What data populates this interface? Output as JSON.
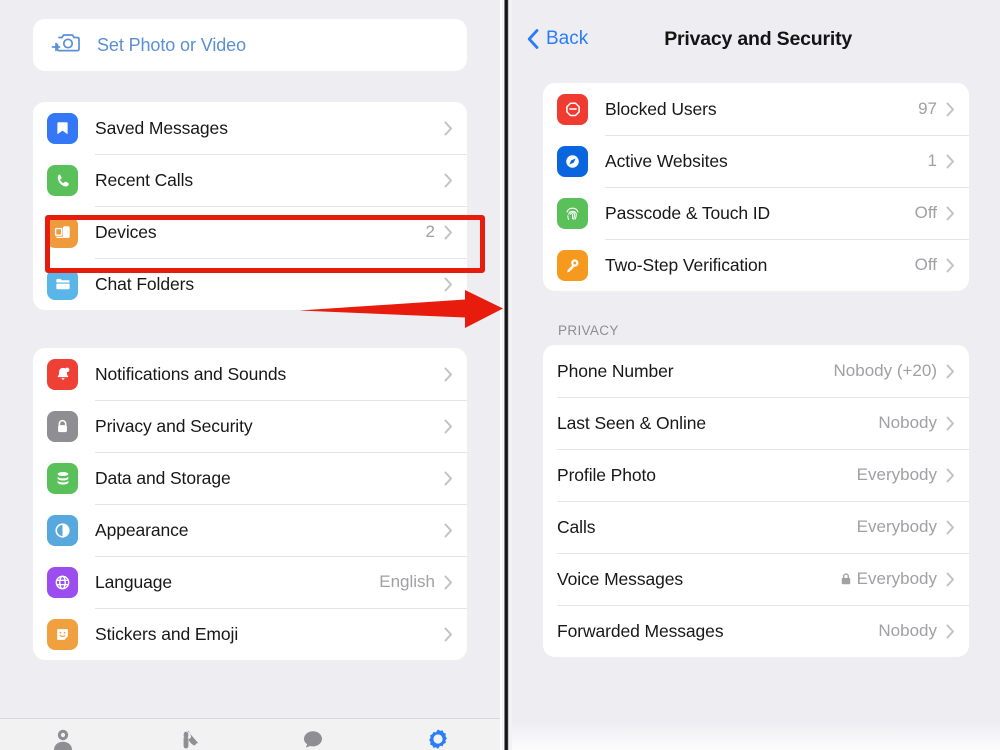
{
  "left_panel": {
    "set_photo": {
      "label": "Set Photo or Video",
      "icon": "camera-plus-icon",
      "color": "#5b8fd6"
    },
    "group_one": [
      {
        "label": "Saved Messages",
        "value": "",
        "icon": "bookmark-icon",
        "color": "#3478f6"
      },
      {
        "label": "Recent Calls",
        "value": "",
        "icon": "phone-icon",
        "color": "#5ac05a"
      },
      {
        "label": "Devices",
        "value": "2",
        "icon": "devices-icon",
        "color": "#f09a3e"
      },
      {
        "label": "Chat Folders",
        "value": "",
        "icon": "folder-icon",
        "color": "#5ab5e8"
      }
    ],
    "group_two": [
      {
        "label": "Notifications and Sounds",
        "value": "",
        "icon": "bell-icon",
        "color": "#ef4036"
      },
      {
        "label": "Privacy and Security",
        "value": "",
        "icon": "lock-icon",
        "color": "#8e8e93"
      },
      {
        "label": "Data and Storage",
        "value": "",
        "icon": "database-icon",
        "color": "#5ac05a"
      },
      {
        "label": "Appearance",
        "value": "",
        "icon": "contrast-icon",
        "color": "#56a8dd"
      },
      {
        "label": "Language",
        "value": "English",
        "icon": "globe-icon",
        "color": "#9b4df0"
      },
      {
        "label": "Stickers and Emoji",
        "value": "",
        "icon": "sticker-icon",
        "color": "#f0a03e"
      }
    ],
    "tabs": [
      {
        "name": "contacts",
        "active": false
      },
      {
        "name": "calls",
        "active": false
      },
      {
        "name": "chats",
        "active": false
      },
      {
        "name": "settings",
        "active": true
      }
    ]
  },
  "right_panel": {
    "nav": {
      "back_label": "Back",
      "title": "Privacy and Security",
      "back_color": "#2a7cf7"
    },
    "security_items": [
      {
        "label": "Blocked Users",
        "value": "97",
        "icon": "block-icon",
        "color": "#ef3b30"
      },
      {
        "label": "Active Websites",
        "value": "1",
        "icon": "compass-icon",
        "color": "#0a66df"
      },
      {
        "label": "Passcode & Touch ID",
        "value": "Off",
        "icon": "fingerprint-icon",
        "color": "#5ac05a"
      },
      {
        "label": "Two-Step Verification",
        "value": "Off",
        "icon": "key-icon",
        "color": "#f59a1e"
      }
    ],
    "privacy_header": "PRIVACY",
    "privacy_items": [
      {
        "label": "Phone Number",
        "value": "Nobody (+20)",
        "locked": false
      },
      {
        "label": "Last Seen & Online",
        "value": "Nobody",
        "locked": false
      },
      {
        "label": "Profile Photo",
        "value": "Everybody",
        "locked": false
      },
      {
        "label": "Calls",
        "value": "Everybody",
        "locked": false
      },
      {
        "label": "Voice Messages",
        "value": "Everybody",
        "locked": true
      },
      {
        "label": "Forwarded Messages",
        "value": "Nobody",
        "locked": false
      }
    ]
  },
  "annotations": {
    "highlight_color": "#e81c0d",
    "highlight_devices_target": "Devices",
    "highlight_twostep_target": "Two-Step Verification",
    "arrow_color": "#e81c0d",
    "arrow_direction": "right"
  }
}
